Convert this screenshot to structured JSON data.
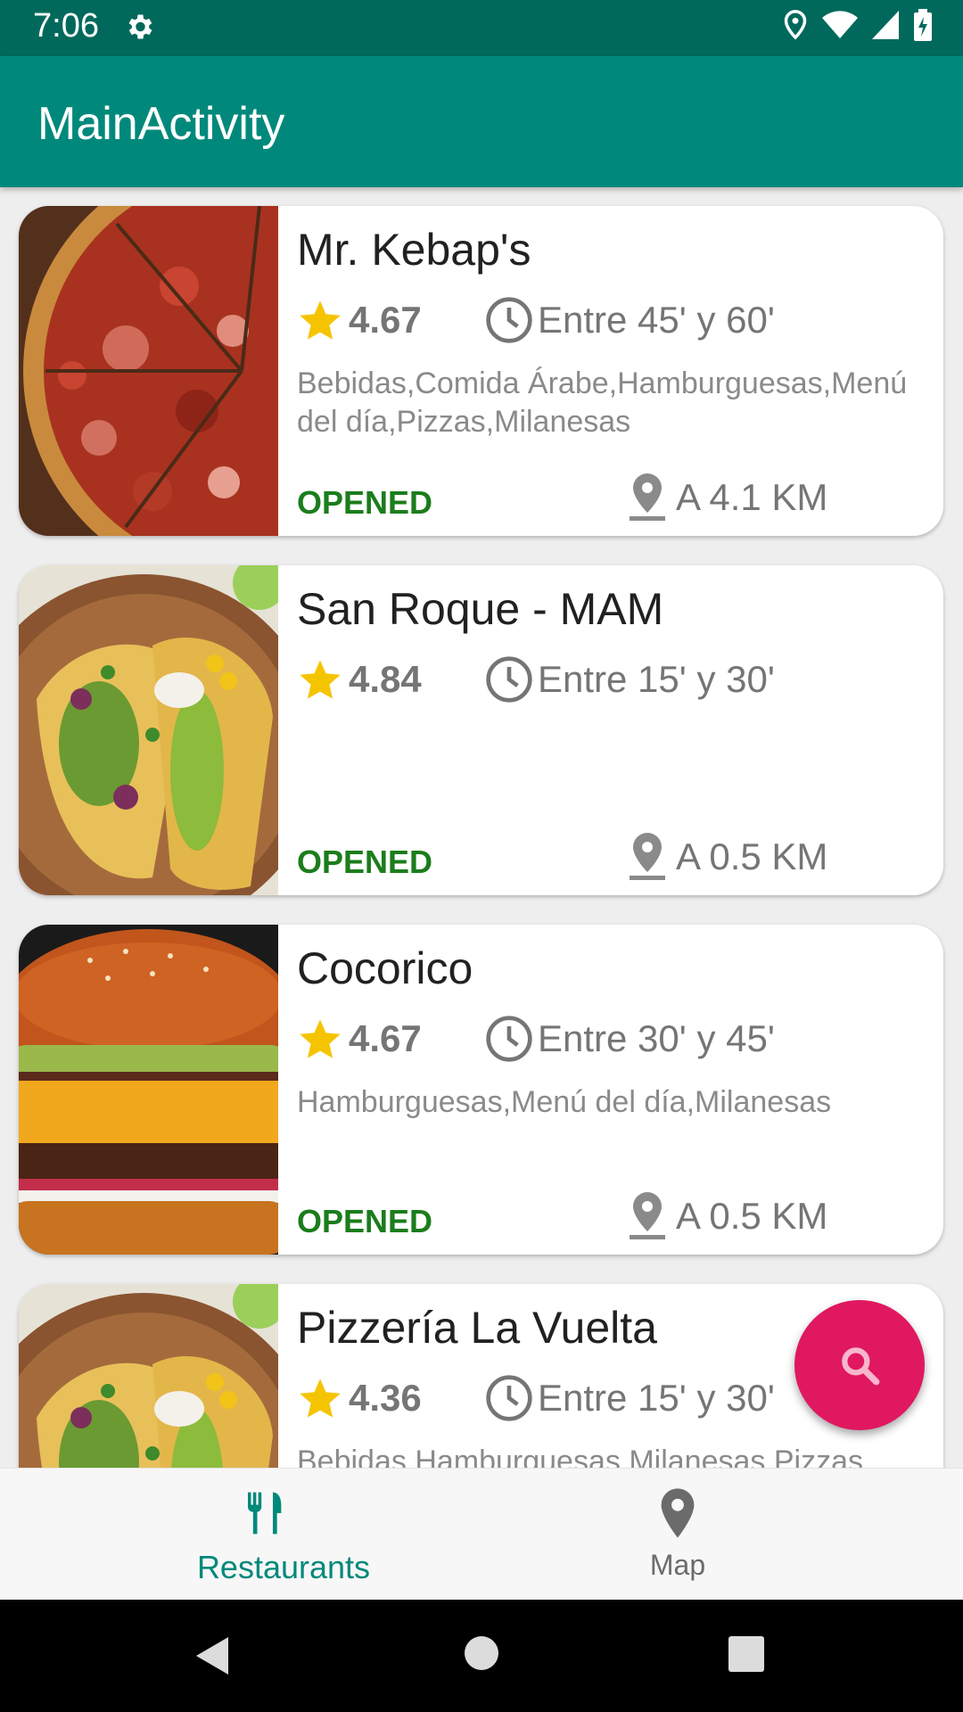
{
  "status_bar": {
    "time": "7:06"
  },
  "app_bar": {
    "title": "MainActivity"
  },
  "restaurants": [
    {
      "name": "Mr. Kebap's",
      "rating": "4.67",
      "eta": "Entre 45' y 60'",
      "categories": "Bebidas,Comida Árabe,Hamburguesas,Menú del día,Pizzas,Milanesas",
      "status": "OPENED",
      "distance": "A 4.1 KM",
      "image": "pizza"
    },
    {
      "name": "San Roque - MAM",
      "rating": "4.84",
      "eta": "Entre 15' y 30'",
      "categories": "",
      "status": "OPENED",
      "distance": "A 0.5 KM",
      "image": "tacos"
    },
    {
      "name": "Cocorico",
      "rating": "4.67",
      "eta": "Entre 30' y 45'",
      "categories": "Hamburguesas,Menú del día,Milanesas",
      "status": "OPENED",
      "distance": "A 0.5 KM",
      "image": "burger"
    },
    {
      "name": "Pizzería La Vuelta",
      "rating": "4.36",
      "eta": "Entre 15' y 30'",
      "categories": "Bebidas,Hamburguesas,Milanesas,Pizzas",
      "status": "",
      "distance": "",
      "image": "tacos"
    }
  ],
  "fab": {
    "icon": "search-icon"
  },
  "bottom_nav": {
    "items": [
      {
        "label": "Restaurants",
        "icon": "fork-knife-icon",
        "active": true
      },
      {
        "label": "Map",
        "icon": "map-pin-icon",
        "active": false
      }
    ]
  },
  "colors": {
    "status_bar": "#00695c",
    "app_bar": "#00897b",
    "fab": "#e0185f",
    "opened": "#1b7d1b",
    "star": "#f5c400"
  }
}
